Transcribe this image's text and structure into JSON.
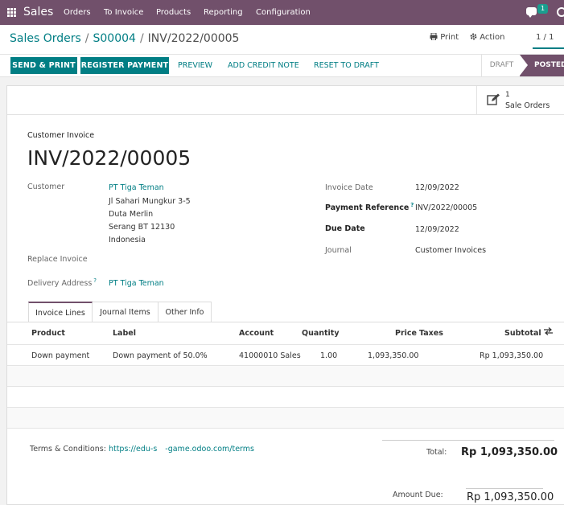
{
  "navbar": {
    "brand": "Sales",
    "menu": [
      "Orders",
      "To Invoice",
      "Products",
      "Reporting",
      "Configuration"
    ],
    "chat_count": "1"
  },
  "breadcrumb": {
    "items": [
      "Sales Orders",
      "S00004",
      "INV/2022/00005"
    ]
  },
  "control": {
    "print_label": "Print",
    "action_label": "Action",
    "pager": "1 / 1"
  },
  "statusbar": {
    "buttons": {
      "send_print": "SEND & PRINT",
      "register_payment": "REGISTER PAYMENT",
      "preview": "PREVIEW",
      "add_credit_note": "ADD CREDIT NOTE",
      "reset_to_draft": "RESET TO DRAFT"
    },
    "stages": {
      "draft": "DRAFT",
      "posted": "POSTED"
    }
  },
  "smart_button": {
    "count": "1",
    "label": "Sale Orders"
  },
  "invoice": {
    "type_label": "Customer Invoice",
    "number": "INV/2022/00005",
    "customer_label": "Customer",
    "customer_name": "PT Tiga Teman",
    "address": [
      "Jl Sahari Mungkur 3-5",
      "Duta Merlin",
      "Serang BT 12130",
      "Indonesia"
    ],
    "replace_invoice_label": "Replace Invoice",
    "delivery_address_label": "Delivery Address",
    "delivery_address_help": "?",
    "delivery_address": "PT Tiga Teman",
    "invoice_date_label": "Invoice Date",
    "invoice_date": "12/09/2022",
    "payment_reference_label": "Payment Reference",
    "payment_reference_help": "?",
    "payment_reference": "INV/2022/00005",
    "due_date_label": "Due Date",
    "due_date": "12/09/2022",
    "journal_label": "Journal",
    "journal": "Customer Invoices"
  },
  "tabs": [
    "Invoice Lines",
    "Journal Items",
    "Other Info"
  ],
  "table": {
    "columns": [
      "Product",
      "Label",
      "Account",
      "Quantity",
      "Price",
      "Taxes",
      "Subtotal"
    ],
    "rows": [
      {
        "product": "Down payment",
        "label": "Down payment of 50.0%",
        "account": "41000010 Sales",
        "quantity": "1.00",
        "price": "1,093,350.00",
        "taxes": "",
        "subtotal": "Rp 1,093,350.00"
      }
    ]
  },
  "footer": {
    "terms_label": "Terms & Conditions:",
    "terms_url_part1": "https://edu-s",
    "terms_url_part2": "-game.odoo.com/terms",
    "total_label": "Total:",
    "total_value": "Rp 1,093,350.00",
    "amount_due_label": "Amount Due:",
    "amount_due_value": "Rp 1,093,350.00"
  },
  "colors": {
    "brand": "#71506b",
    "accent": "#017e84"
  }
}
